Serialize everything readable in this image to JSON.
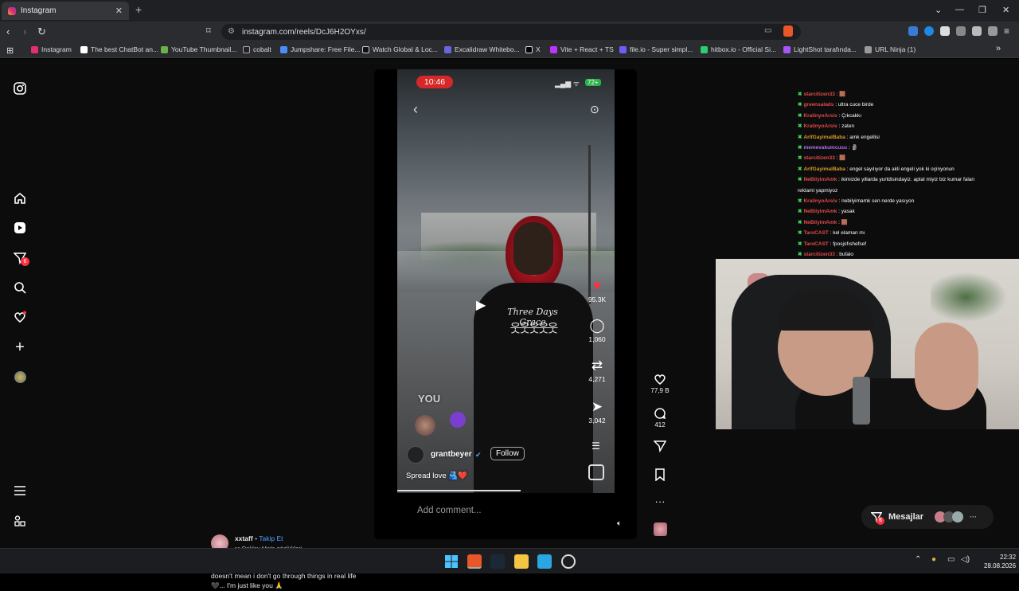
{
  "browser": {
    "tab_title": "Instagram",
    "tab_close": "✕",
    "new_tab": "+",
    "url": "instagram.com/reels/DcJ6H2OYxs/",
    "bookmarks": [
      "Instagram",
      "The best ChatBot an...",
      "YouTube Thumbnail...",
      "cobalt",
      "Jumpshare: Free File...",
      "Watch Global & Loc...",
      "Excalidraw Whitebo...",
      "X",
      "Vite + React + TS",
      "file.io - Super simpl...",
      "hitbox.io - Official Si...",
      "LightShot tarafında...",
      "URL Ninja (1)"
    ],
    "bookmarks_overflow": "»"
  },
  "sidebar": {
    "notification_badge": "6"
  },
  "reel": {
    "status_time": "10:46",
    "battery": "72+",
    "phone_likes": "95.3K",
    "phone_comments": "1,060",
    "phone_reposts": "4,271",
    "phone_shares": "3,042",
    "shirt_text": "Three Days Grace",
    "you_label": "YOU",
    "username": "grantbeyer",
    "follow_label": "Follow",
    "phone_caption": "Spread love 🫂❤️",
    "add_comment": "Add comment...",
    "likes": "77,9 B",
    "comments": "412"
  },
  "post": {
    "author": "xxtaff",
    "follow_label": "Takip Et",
    "audio": "Oakley Meta gözlükleri",
    "caption": "Just because I have a following on social media doesn't mean i don't go through things in real life 🖤... I'm just like you 🙏"
  },
  "chat": [
    {
      "user": "starcitizen33",
      "color": "red",
      "msg": "🟫"
    },
    {
      "user": "greensalads",
      "color": "red",
      "msg": "ultra cuce birde"
    },
    {
      "user": "KralinyoArsiv",
      "color": "red",
      "msg": "Çıkcakkı"
    },
    {
      "user": "KralinyoArsiv",
      "color": "red",
      "msg": "zaten"
    },
    {
      "user": "ArifGayimalBaba",
      "color": "yel",
      "msg": "amk engellisi"
    },
    {
      "user": "memevakumcusu",
      "color": "purp",
      "msg": "🗿"
    },
    {
      "user": "starcitizen33",
      "color": "red",
      "msg": "🟫"
    },
    {
      "user": "ArifGayimalBaba",
      "color": "yel",
      "msg": "engel sayılıyor da akli engeli yok ki oçinyonun"
    },
    {
      "user": "NeBilyimAmk",
      "color": "red",
      "msg": "ikimizde yillarda yurtdisindayiz. aptal miyiz biz kumar falan"
    },
    {
      "user": "",
      "color": "red",
      "msg": "reklami yapmiyoz"
    },
    {
      "user": "KralinyoArsiv",
      "color": "red",
      "msg": "nebilyimamk sen nerde yasıyon"
    },
    {
      "user": "NeBilyimAmk",
      "color": "red",
      "msg": "yasak"
    },
    {
      "user": "NeBilyimAmk",
      "color": "red",
      "msg": "🟫"
    },
    {
      "user": "TaroCAST",
      "color": "red",
      "msg": "kel elaman mı"
    },
    {
      "user": "TaroCAST",
      "color": "red",
      "msg": "fposjofıshefsef"
    },
    {
      "user": "starcitizen33",
      "color": "red",
      "msg": "bufalo"
    }
  ],
  "messages": {
    "label": "Mesajlar",
    "badge": "6",
    "more": "···"
  },
  "taskbar": {
    "time": "22:32",
    "date": "28.08.2026"
  },
  "colors": {
    "instagram_gradient": [
      "#f9a33a",
      "#e1306c",
      "#833ab4"
    ],
    "like_red": "#ff3040",
    "status_red": "#d62828",
    "chat_badge_green": "#3bd35b"
  }
}
